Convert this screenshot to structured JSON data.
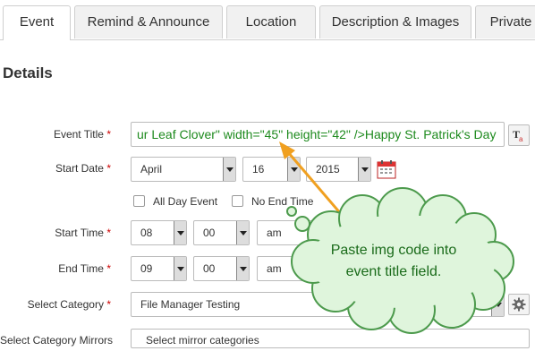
{
  "tabs": [
    {
      "label": "Event"
    },
    {
      "label": "Remind & Announce"
    },
    {
      "label": "Location"
    },
    {
      "label": "Description & Images"
    },
    {
      "label": "Private"
    }
  ],
  "section": {
    "title": "Details"
  },
  "fields": {
    "event_title": {
      "label": "Event Title",
      "required": "*",
      "value": "ur Leaf Clover\" width=\"45\" height=\"42\" />Happy St. Patrick's Day"
    },
    "start_date": {
      "label": "Start Date",
      "required": "*",
      "month": "April",
      "day": "16",
      "year": "2015"
    },
    "all_day": {
      "label": "All Day Event"
    },
    "no_end_time": {
      "label": "No End Time"
    },
    "start_time": {
      "label": "Start Time",
      "required": "*",
      "hour": "08",
      "minute": "00",
      "ampm": "am"
    },
    "end_time": {
      "label": "End Time",
      "required": "*",
      "hour": "09",
      "minute": "00",
      "ampm": "am"
    },
    "category": {
      "label": "Select Category",
      "required": "*",
      "value": "File Manager Testing"
    },
    "category_mirrors": {
      "label": "Select Category Mirrors",
      "value": "Select mirror categories"
    }
  },
  "callout": {
    "line1": "Paste img code into",
    "line2": "event title field."
  },
  "colors": {
    "title_text": "#1d8a1d",
    "arrow": "#f0a020",
    "callout_fill": "#dff5dc",
    "callout_stroke": "#4c9a4c",
    "callout_text": "#1a6b1a"
  },
  "icons": [
    "text-format-icon",
    "calendar-icon",
    "gear-icon",
    "chevron-down-icon"
  ]
}
